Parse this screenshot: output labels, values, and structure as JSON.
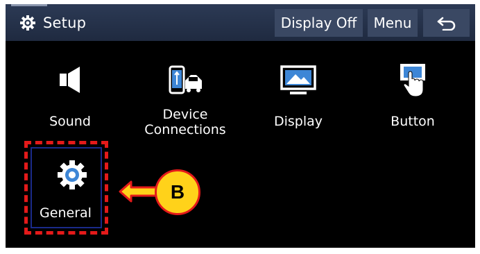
{
  "header": {
    "title": "Setup",
    "display_off_label": "Display Off",
    "menu_label": "Menu",
    "back_icon": "back-arrow-icon",
    "settings_icon": "gear-icon"
  },
  "tiles": [
    {
      "label": "Sound",
      "icon": "speaker-icon"
    },
    {
      "label_line1": "Device",
      "label_line2": "Connections",
      "icon": "phone-car-icon"
    },
    {
      "label": "Display",
      "icon": "monitor-icon"
    },
    {
      "label": "Button",
      "icon": "touch-button-icon"
    },
    {
      "label": "General",
      "icon": "gear-icon"
    }
  ],
  "annotation": {
    "callout_letter": "B",
    "highlight_color": "#e41a1a",
    "callout_color": "#ffd21a"
  },
  "colors": {
    "header_bg": "#2c3a55",
    "button_bg": "#3a4863",
    "screen_bg": "#000000",
    "icon_accent": "#3d86d6"
  }
}
